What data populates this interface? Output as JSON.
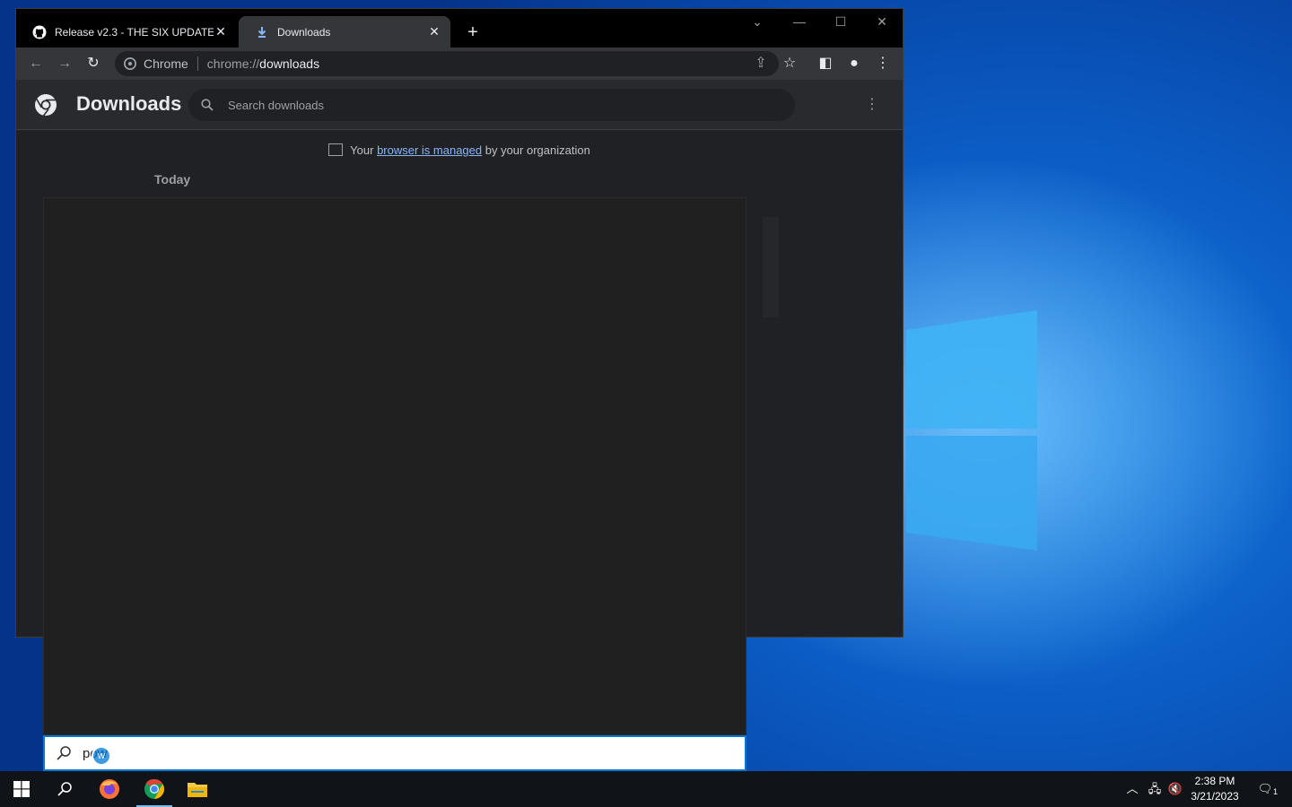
{
  "browser": {
    "tabs": [
      {
        "title": "Release v2.3 - THE SIX UPDATE · ",
        "close": "✕"
      },
      {
        "title": "Downloads",
        "close": "✕"
      }
    ],
    "new_tab": "+",
    "omnibox": {
      "site": "Chrome",
      "scheme": "chrome://",
      "host": "downloads"
    }
  },
  "downloads_page": {
    "title": "Downloads",
    "search_placeholder": "Search downloads",
    "managed_prefix": "Your ",
    "managed_link": "browser is managed",
    "managed_suffix": " by your organization",
    "section_label": "Today"
  },
  "start_search": {
    "query": "pow",
    "cursor_letter": "w"
  },
  "taskbar": {
    "time": "2:38 PM",
    "date": "3/21/2023",
    "notification_count": "1"
  }
}
